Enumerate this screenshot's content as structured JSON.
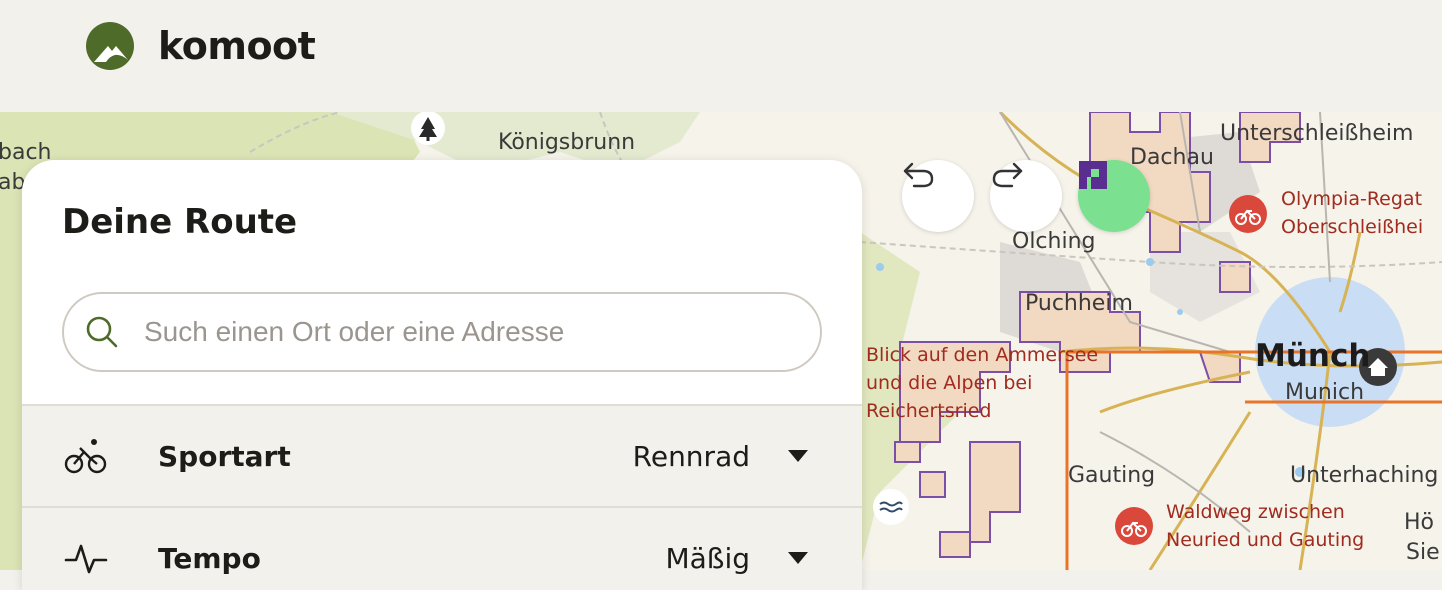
{
  "header": {
    "brand": "komoot"
  },
  "map": {
    "labels": {
      "koenigsbrunn": "Königsbrunn",
      "edge_top": "bach",
      "edge_second": "abe",
      "dachau": "Dachau",
      "unterschleissheim": "Unterschleißheim",
      "olympia": "Olympia-Regat\nOberschleißhei",
      "olching": "Olching",
      "puchheim": "Puchheim",
      "blick": "Blick auf den Ammersee\nund die Alpen bei\nReichertsried",
      "muenchen": "Münch",
      "munich": "Munich",
      "gauting": "Gauting",
      "unterhaching": "Unterhaching",
      "waldweg": "Waldweg zwischen\nNeuried und Gauting",
      "hoe": "Hö",
      "sie": "Sie"
    },
    "icons": [
      "tree-icon",
      "bike-poi-icon",
      "bike-poi-icon",
      "bike-poi-icon",
      "home-icon",
      "water-icon"
    ]
  },
  "controls": {
    "undo_icon": "undo-icon",
    "redo_icon": "redo-icon",
    "layers_icon": "layers-icon"
  },
  "panel": {
    "title": "Deine Route",
    "search": {
      "placeholder": "Such einen Ort oder eine Adresse",
      "value": ""
    },
    "rows": [
      {
        "icon": "bike-icon",
        "label": "Sportart",
        "value": "Rennrad"
      },
      {
        "icon": "pulse-icon",
        "label": "Tempo",
        "value": "Mäßig"
      }
    ]
  },
  "colors": {
    "brand_green": "#4f6b2a",
    "poi_red": "#d9483b",
    "layer_green": "#7be08f",
    "layer_purple": "#5a2d91",
    "boundary_orange": "#e8742a",
    "protected_purple": "#7b4fa8"
  }
}
